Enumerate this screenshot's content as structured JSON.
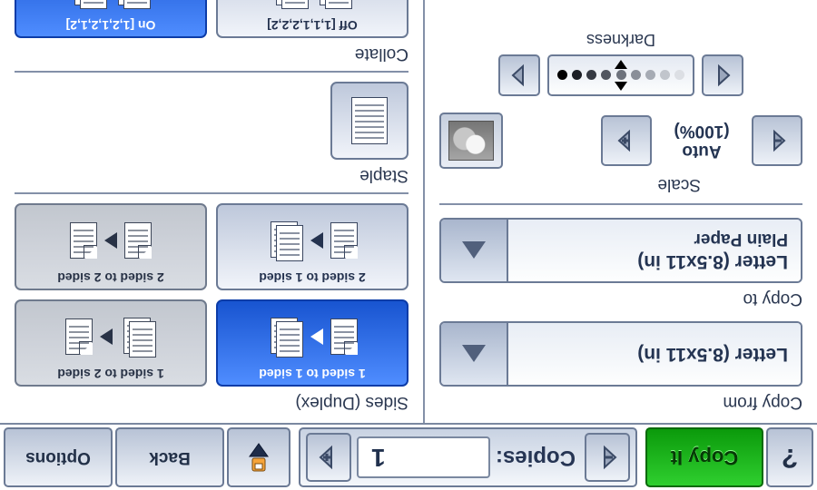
{
  "topbar": {
    "help_label": "?",
    "copy_it_label": "Copy It",
    "copies_label": "Copies:",
    "copies_value": "1",
    "back_label": "Back",
    "options_label": "Options"
  },
  "left": {
    "copy_from": {
      "title": "Copy from",
      "line1": "Letter (8.5x11 in)"
    },
    "copy_to": {
      "title": "Copy to",
      "line1": "Letter (8.5x11 in)",
      "line2": "Plain Paper"
    },
    "scale": {
      "title": "Scale",
      "value_line1": "Auto",
      "value_line2": "(100%)"
    },
    "darkness": {
      "title": "Darkness",
      "index": 4,
      "levels": 9
    }
  },
  "right": {
    "sides": {
      "title": "Sides (Duplex)",
      "options": [
        {
          "label": "1 sided to 1 sided",
          "selected": true
        },
        {
          "label": "1 sided to 2 sided",
          "selected": false
        },
        {
          "label": "2 sided to 1 sided",
          "selected": false
        },
        {
          "label": "2 sided to 2 sided",
          "selected": false
        }
      ]
    },
    "staple": {
      "title": "Staple"
    },
    "collate": {
      "title": "Collate",
      "options": [
        {
          "label": "Off [1,1,1,2,2,2]",
          "selected": false
        },
        {
          "label": "On [1,2,1,2,1,2]",
          "selected": true
        }
      ]
    }
  }
}
